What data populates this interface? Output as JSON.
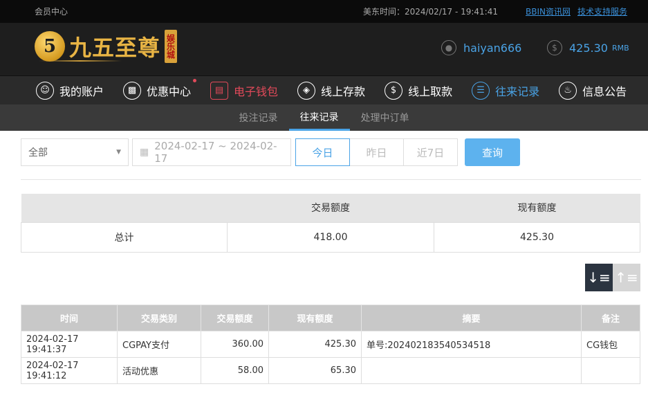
{
  "topbar": {
    "member_center": "会员中心",
    "time": "美东时间：2024/02/17 - 19:41:41",
    "link1": "BBIN资讯网",
    "link2": "技术支持服务"
  },
  "header": {
    "logo_text": "九五至尊",
    "logo_tag": "娱乐城",
    "username": "haiyan666",
    "balance": "425.30",
    "currency": "RMB"
  },
  "nav": {
    "items": [
      {
        "label": "我的账户"
      },
      {
        "label": "优惠中心"
      },
      {
        "label": "电子钱包"
      },
      {
        "label": "线上存款"
      },
      {
        "label": "线上取款"
      },
      {
        "label": "往来记录"
      },
      {
        "label": "信息公告"
      }
    ]
  },
  "subnav": {
    "items": [
      {
        "label": "投注记录"
      },
      {
        "label": "往来记录"
      },
      {
        "label": "处理中订单"
      }
    ]
  },
  "filters": {
    "type": "全部",
    "date_range": "2024-02-17 ~ 2024-02-17",
    "today": "今日",
    "yesterday": "昨日",
    "last7": "近7日",
    "query": "查询"
  },
  "summary": {
    "headers": [
      "",
      "交易额度",
      "现有额度"
    ],
    "row": {
      "label": "总计",
      "amount": "418.00",
      "balance": "425.30"
    }
  },
  "detail": {
    "headers": [
      "时间",
      "交易类别",
      "交易额度",
      "现有额度",
      "摘要",
      "备注"
    ],
    "rows": [
      {
        "time": "2024-02-17 19:41:37",
        "type": "CGPAY支付",
        "amount": "360.00",
        "balance": "425.30",
        "summary": "单号:202402183540534518",
        "note": "CG钱包"
      },
      {
        "time": "2024-02-17 19:41:12",
        "type": "活动优惠",
        "amount": "58.00",
        "balance": "65.30",
        "summary": "",
        "note": ""
      }
    ]
  },
  "colors": {
    "accent": "#4aa3e6",
    "red": "#e24a5a",
    "gold": "#e8b444"
  }
}
